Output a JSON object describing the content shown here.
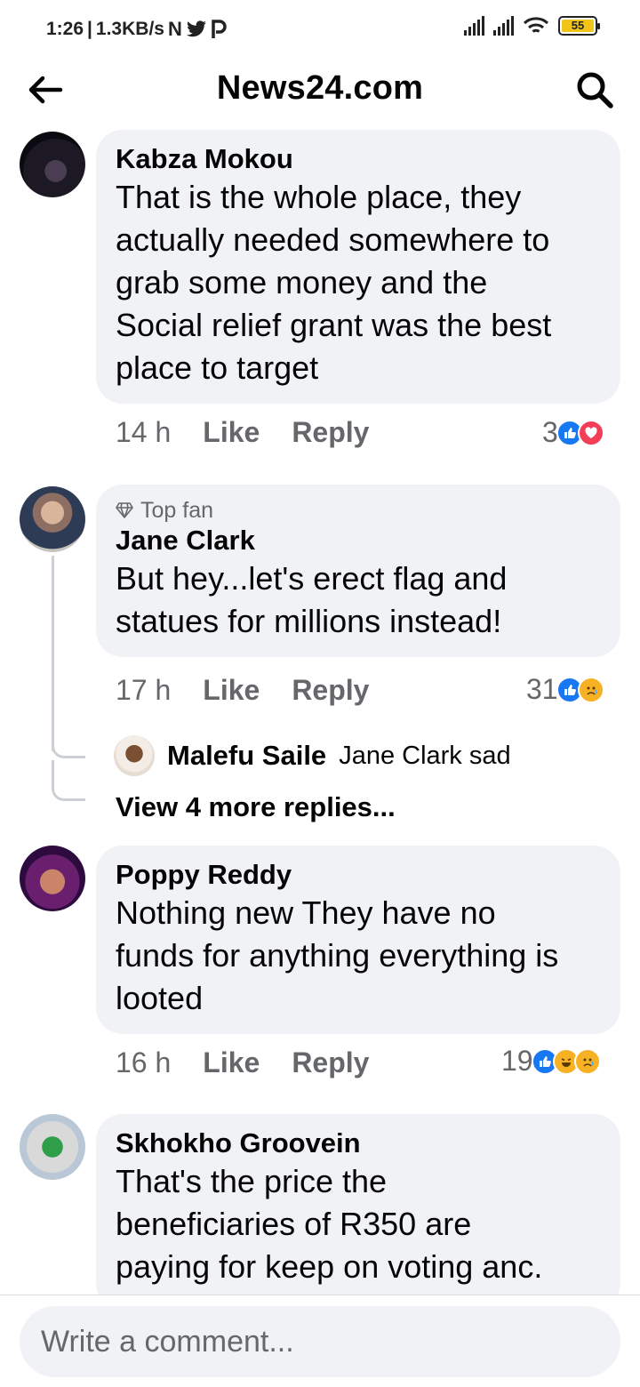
{
  "status_bar": {
    "time": "1:26",
    "speed": "1.3KB/s",
    "battery": "55"
  },
  "header": {
    "title": "News24.com"
  },
  "comments": [
    {
      "name": "Kabza Mokou",
      "text_lines": [
        "That is the whole place, they",
        "actually needed somewhere to",
        "grab some money and the",
        "Social relief grant was the best",
        "place to target"
      ],
      "time": "14 h",
      "like": "Like",
      "reply": "Reply",
      "reaction_count": "3"
    },
    {
      "badge": "Top fan",
      "name": "Jane Clark",
      "text_lines": [
        "But hey...let's erect flag and",
        "statues for millions instead!"
      ],
      "time": "17 h",
      "like": "Like",
      "reply": "Reply",
      "reaction_count": "31",
      "reply_preview": {
        "name": "Malefu Saile",
        "text": "Jane Clark sad"
      },
      "view_more": "View 4 more replies..."
    },
    {
      "name": "Poppy Reddy",
      "text_lines": [
        "Nothing new They have no",
        "funds for anything everything is",
        "looted"
      ],
      "time": "16 h",
      "like": "Like",
      "reply": "Reply",
      "reaction_count": "19"
    },
    {
      "name": "Skhokho Groovein",
      "text_lines": [
        "That's the price the",
        "beneficiaries of R350 are",
        "paying for keep on voting anc."
      ]
    }
  ],
  "compose": {
    "placeholder": "Write a comment..."
  },
  "colors": {
    "like_blue": "#1877f2",
    "love_red": "#f33e58",
    "emoji_yellow": "#f7b125",
    "bubble_bg": "#f0f2f5"
  }
}
